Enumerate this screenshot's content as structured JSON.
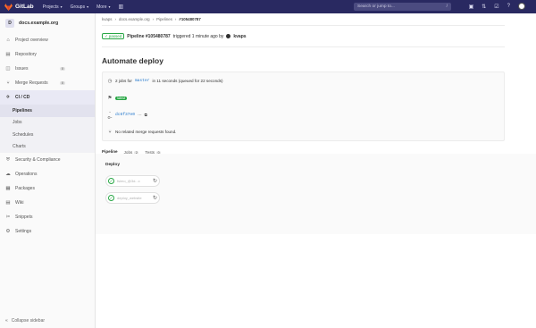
{
  "topbar": {
    "brand": "GitLab",
    "menus": [
      "Projects",
      "Groups",
      "More"
    ],
    "search_placeholder": "Search or jump to...",
    "search_shortcut": "/"
  },
  "sidebar": {
    "project_initial": "D",
    "project_name": "docs.example.org",
    "items": [
      {
        "label": "Project overview",
        "icon": "home-icon"
      },
      {
        "label": "Repository",
        "icon": "book-icon"
      },
      {
        "label": "Issues",
        "icon": "issues-icon",
        "count": "0"
      },
      {
        "label": "Merge Requests",
        "icon": "merge-request-icon",
        "count": "0"
      },
      {
        "label": "CI / CD",
        "icon": "rocket-icon"
      }
    ],
    "ci_sub": [
      "Pipelines",
      "Jobs",
      "Schedules",
      "Charts"
    ],
    "items_after": [
      {
        "label": "Security & Compliance",
        "icon": "shield-icon"
      },
      {
        "label": "Operations",
        "icon": "cloud-icon"
      },
      {
        "label": "Packages",
        "icon": "package-icon"
      },
      {
        "label": "Wiki",
        "icon": "book-icon"
      },
      {
        "label": "Snippets",
        "icon": "snippet-icon"
      },
      {
        "label": "Settings",
        "icon": "gear-icon"
      }
    ],
    "collapse_label": "Collapse sidebar"
  },
  "breadcrumb": [
    "kvaps",
    "docs.example.org",
    "Pipelines",
    "#105480787"
  ],
  "header": {
    "status": "passed",
    "pipeline_id": "Pipeline #105480787",
    "triggered": "triggered 1 minute ago by",
    "user": "kvaps"
  },
  "page_title": "Automate deploy",
  "info": {
    "jobs_text_1": "2 jobs for",
    "branch": "master",
    "jobs_text_2": "in 11 seconds (queued for 22 seconds)",
    "latest": "latest",
    "commit": "dc6f37e0",
    "mr_text": "No related merge requests found."
  },
  "tabs": [
    {
      "label": "Pipeline",
      "count": ""
    },
    {
      "label": "Jobs",
      "count": "2"
    },
    {
      "label": "Tests",
      "count": "0"
    }
  ],
  "stage": {
    "title": "Deploy",
    "jobs": [
      "fsimo_@3d...c",
      "deploy_website"
    ]
  }
}
